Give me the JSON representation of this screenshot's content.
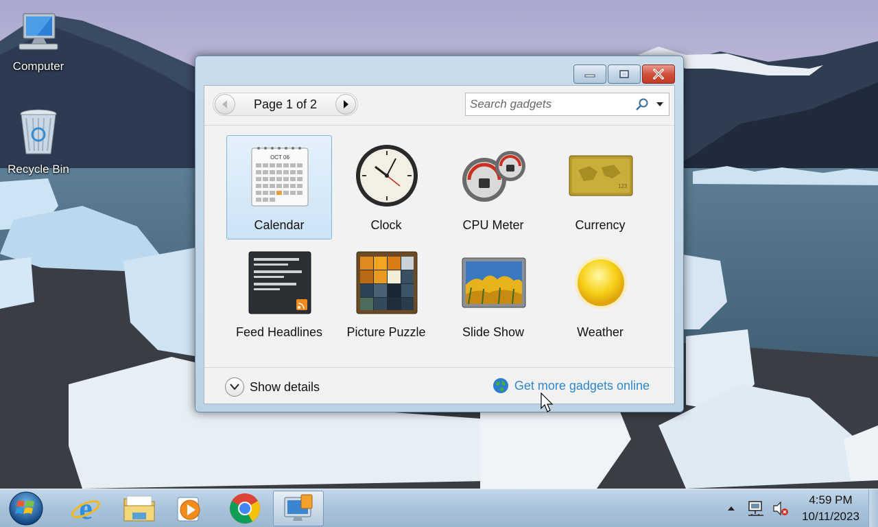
{
  "desktop": {
    "icons": [
      {
        "label": "Computer",
        "icon": "computer-icon"
      },
      {
        "label": "Recycle Bin",
        "icon": "recycle-bin-icon"
      }
    ]
  },
  "window": {
    "buttons": {
      "minimize": "minimize-icon",
      "maximize": "maximize-icon",
      "close": "close-icon"
    },
    "pager": {
      "label": "Page 1 of 2"
    },
    "search": {
      "placeholder": "Search gadgets"
    },
    "gadgets": [
      {
        "label": "Calendar",
        "icon": "calendar-icon",
        "selected": true
      },
      {
        "label": "Clock",
        "icon": "clock-icon"
      },
      {
        "label": "CPU Meter",
        "icon": "cpu-meter-icon"
      },
      {
        "label": "Currency",
        "icon": "currency-icon"
      },
      {
        "label": "Feed Headlines",
        "icon": "feed-headlines-icon"
      },
      {
        "label": "Picture Puzzle",
        "icon": "picture-puzzle-icon"
      },
      {
        "label": "Slide Show",
        "icon": "slide-show-icon"
      },
      {
        "label": "Weather",
        "icon": "weather-icon"
      }
    ],
    "calendar_thumb": {
      "month": "OCT 06"
    },
    "footer": {
      "show_details": "Show details",
      "get_more": "Get more gadgets online"
    }
  },
  "taskbar": {
    "items": [
      {
        "name": "start-button",
        "icon": "windows-logo-icon"
      },
      {
        "name": "internet-explorer",
        "icon": "internet-explorer-icon"
      },
      {
        "name": "file-explorer",
        "icon": "folder-icon"
      },
      {
        "name": "media-player",
        "icon": "media-player-icon"
      },
      {
        "name": "chrome",
        "icon": "chrome-icon"
      },
      {
        "name": "gadgets",
        "icon": "gadgets-icon",
        "active": true
      }
    ],
    "tray": {
      "time": "4:59 PM",
      "date": "10/11/2023"
    }
  },
  "colors": {
    "link": "#2f86c9",
    "selection_border": "#7eb4ea",
    "close_button": "#c23a27"
  }
}
